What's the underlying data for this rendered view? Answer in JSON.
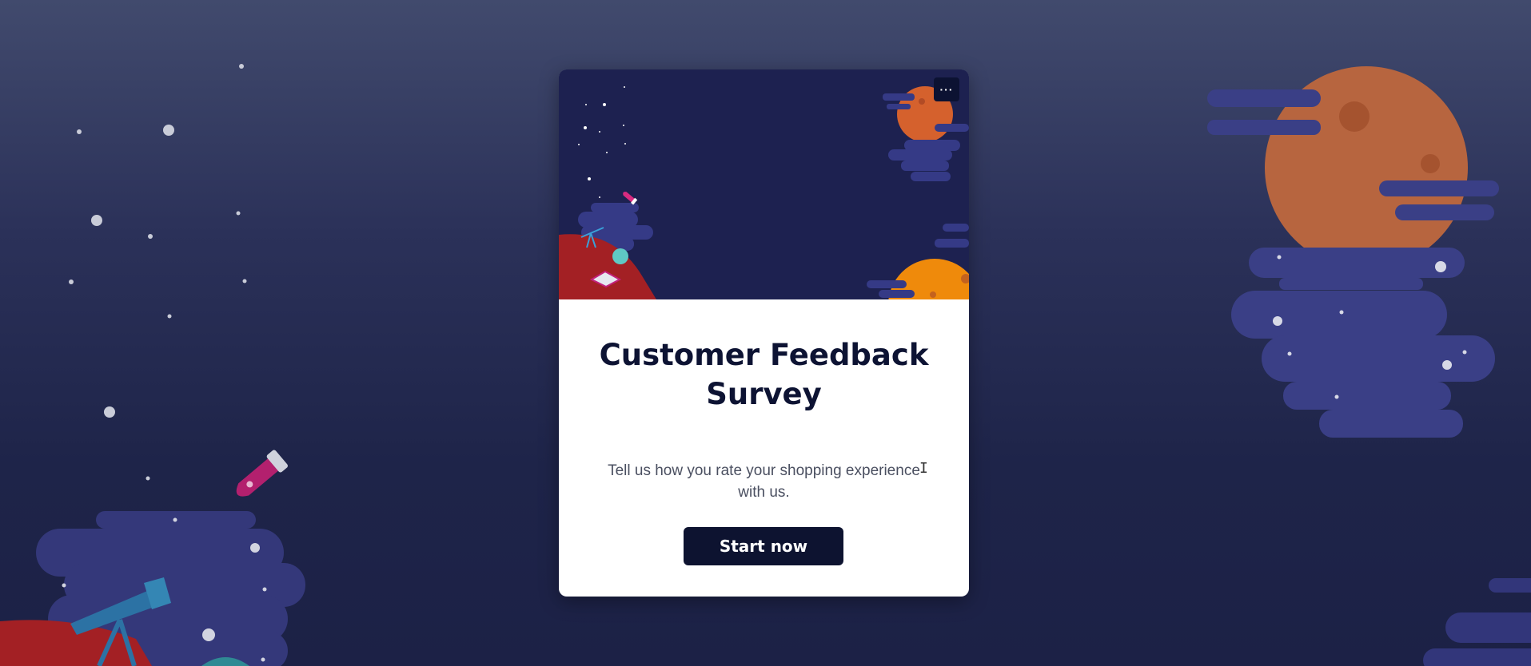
{
  "survey": {
    "title": "Customer Feedback Survey",
    "description": "Tell us how you rate your shopping experience with us.",
    "start_label": "Start now",
    "menu_label": "···"
  },
  "colors": {
    "background_top": "#414a6d",
    "background_bottom": "#1c2146",
    "hero_background": "#1d2150",
    "button_background": "#0d1330",
    "title_color": "#0d1333",
    "planet_orange": "#b9643f",
    "planet_yellow": "#ef8a0b",
    "planet_red": "#a32024",
    "cloud_purple": "#363a7e"
  }
}
